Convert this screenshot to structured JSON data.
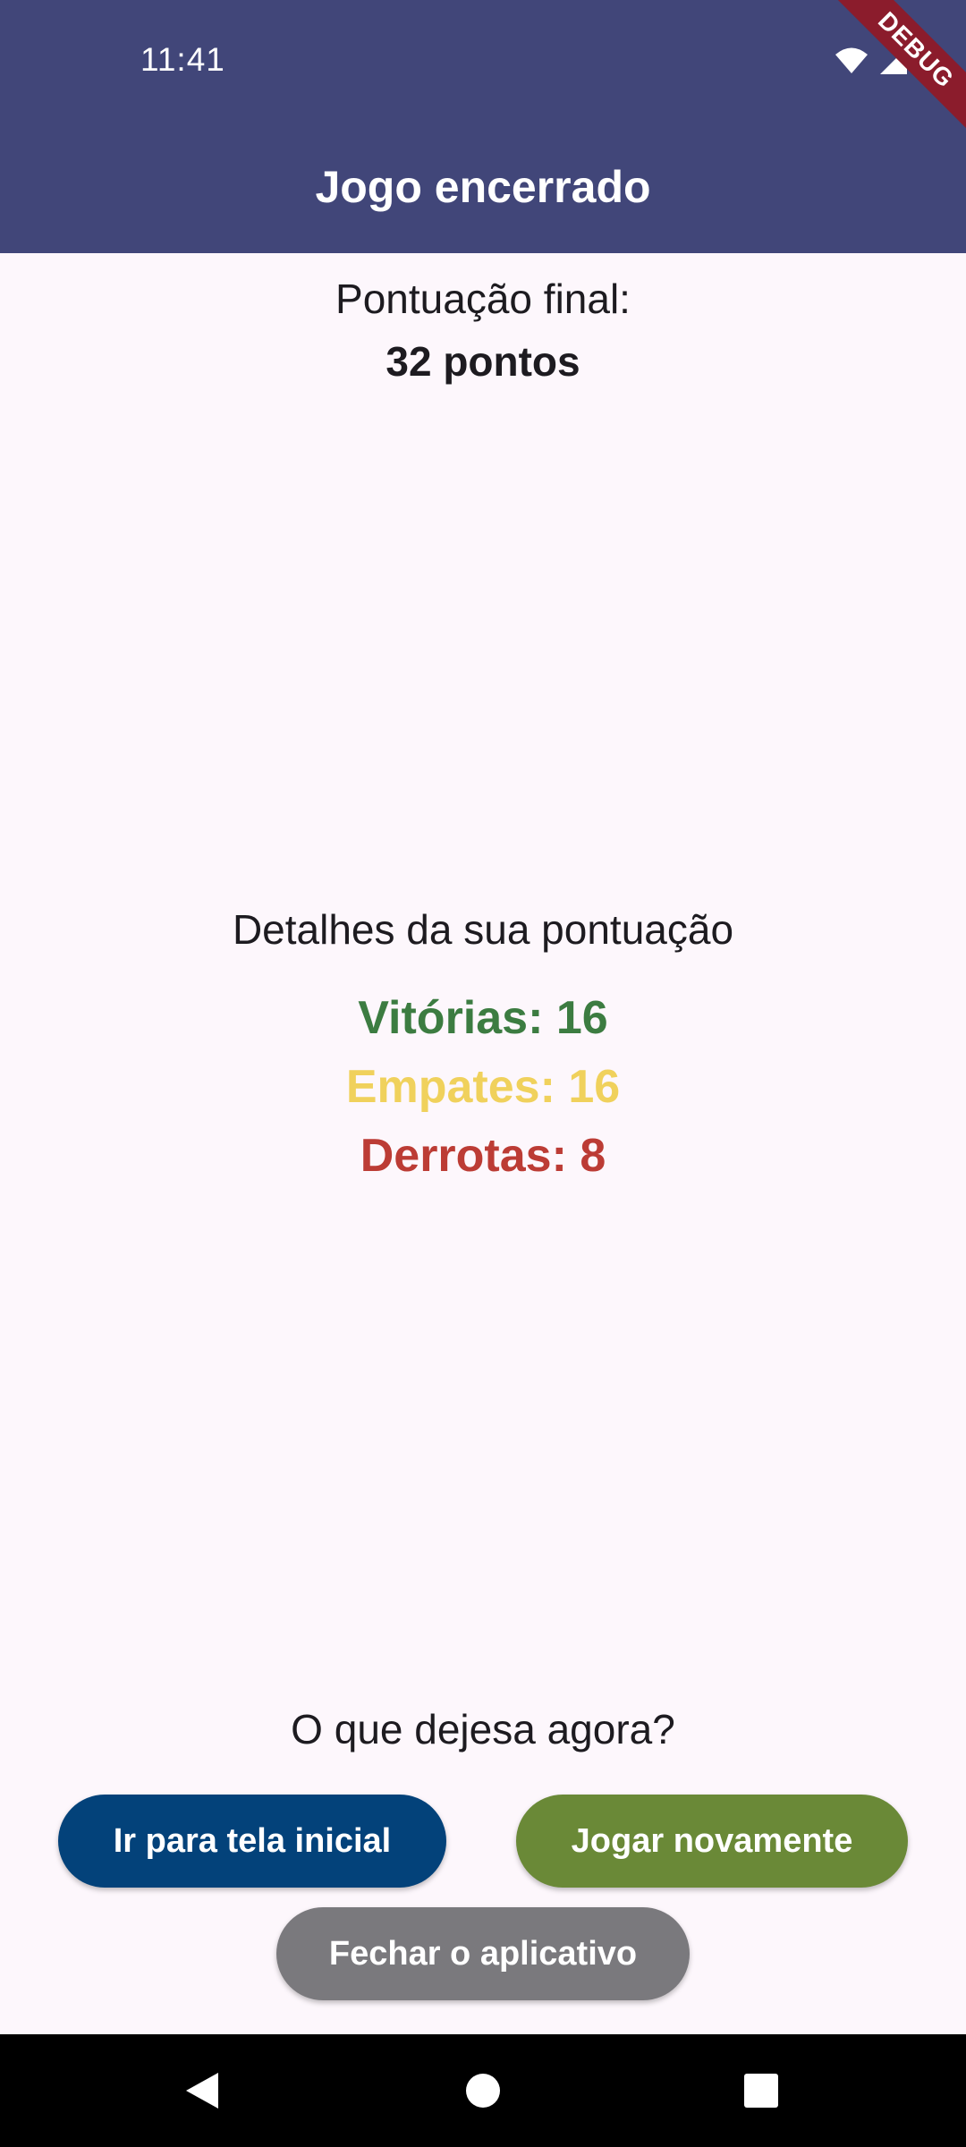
{
  "status_bar": {
    "time": "11:41",
    "icons": [
      "wifi-icon",
      "signal-icon",
      "battery-icon"
    ]
  },
  "app_bar": {
    "title": "Jogo encerrado",
    "debug_label": "DEBUG"
  },
  "score": {
    "label": "Pontuação final:",
    "value": "32 pontos"
  },
  "details": {
    "title": "Detalhes da sua pontuação",
    "wins": "Vitórias: 16",
    "draws": "Empates: 16",
    "losses": "Derrotas: 8"
  },
  "actions": {
    "prompt": "O que dejesa agora?",
    "home_label": "Ir para tela inicial",
    "replay_label": "Jogar novamente",
    "close_label": "Fechar o aplicativo"
  },
  "nav_bar": {
    "icons": [
      "back-icon",
      "home-icon",
      "recents-icon"
    ]
  },
  "colors": {
    "app_bar": "#414679",
    "background": "#fdf7fc",
    "wins": "#3c7c41",
    "draws": "#f0d15c",
    "losses": "#bc3c35",
    "home_button": "#03427a",
    "replay_button": "#6a8937",
    "close_button": "#7a797d",
    "debug_banner": "#8b1c2c"
  }
}
